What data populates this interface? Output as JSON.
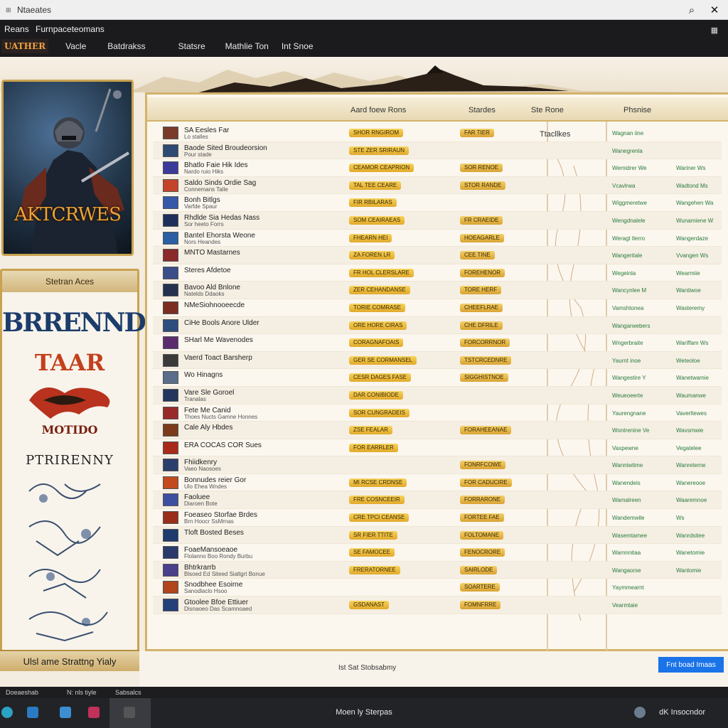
{
  "window": {
    "title": "Ntaeates",
    "app_icon": "window-icon"
  },
  "topbar": {
    "brand_main": "Reans",
    "brand_sub": "Furnpaceteomans",
    "menu_icon": "grid-icon",
    "logo": "UATHER",
    "nav": [
      "Vacle",
      "Batdrakss",
      "Statsre",
      "Mathlie Ton",
      "Int Snoe"
    ]
  },
  "cover": {
    "title": "AKTCRWES"
  },
  "sidebar": {
    "header": "Stetran Aces",
    "title1": "BRRENND",
    "title2": "TAAR",
    "title3": "MOTIDO",
    "title4": "PTRIRENNY",
    "footer": "Ulsl ame Strattng Yialy"
  },
  "table": {
    "headers": [
      "Aard foew Rons",
      "Stardes",
      "Ste Rone",
      "Phsnise"
    ],
    "features_label": "Ttacllkes",
    "rows": [
      {
        "name": "SA Eesles Far",
        "sub": "Lo stalles",
        "tag1": "SHOR RNGIROM",
        "tag2": "FAR TIER",
        "g1": "Wagnan iine",
        "g2": "",
        "color": "#7a3b2a"
      },
      {
        "name": "Baode Sited Broudeorsion",
        "sub": "Pour stade",
        "tag1": "STE ZER SRIRAUN",
        "tag2": "",
        "g1": "Wanegrenla",
        "g2": "",
        "color": "#2c4a73"
      },
      {
        "name": "Bhatlo Faie Hik Ides",
        "sub": "Nardo ruio Hiks",
        "tag1": "CEAMOR CEAPRION",
        "tag2": "SOR RENOE",
        "g1": "Wemidrer We",
        "g2": "Wariner Ws",
        "color": "#3b3b9a"
      },
      {
        "name": "Saldo Sinds Ordie Sag",
        "sub": "Connemans Talle",
        "tag1": "TAL TEE CEARE",
        "tag2": "STOR RANDE",
        "g1": "Vcavlrwa",
        "g2": "Wadtond Ms",
        "color": "#c4442a"
      },
      {
        "name": "Bonh Bitlgs",
        "sub": "Varfde Spaur",
        "tag1": "FIR RBILARAS",
        "tag2": "",
        "g1": "Wiggmeretwe",
        "g2": "Wangehen Wa",
        "color": "#3559a8"
      },
      {
        "name": "Rhdlde Sia Hedas Nass",
        "sub": "Sor heeto Forrs",
        "tag1": "SOM CEAIRAEAS",
        "tag2": "FR CRAEIDE",
        "g1": "Wengdnalele",
        "g2": "Wunamiene W",
        "color": "#1e2f5c"
      },
      {
        "name": "Bantel Ehorsta Weone",
        "sub": "Nors Heandes",
        "tag1": "FHEARN HEI",
        "tag2": "HOEAGARLE",
        "g1": "Weragt tlerro",
        "g2": "Wangerdaze",
        "color": "#2a5fa3"
      },
      {
        "name": "MNTO Mastarnes",
        "sub": "",
        "tag1": "ZA FOREN LR",
        "tag2": "CEE TINE",
        "g1": "Wangeritale",
        "g2": "Vvangen Ws",
        "color": "#8a2a2a"
      },
      {
        "name": "Steres Afdetoe",
        "sub": "",
        "tag1": "FR HOL CLERSLARE",
        "tag2": "FOREHENOR",
        "g1": "Wegeinla",
        "g2": "Wearmiie",
        "color": "#3a4f8a"
      },
      {
        "name": "Bavoo Ald Bnlone",
        "sub": "Natelds Ddaoks",
        "tag1": "ZER CEHANDANSE",
        "tag2": "TORE HERF",
        "g1": "Wancynlee M",
        "g2": "Wantiwoe",
        "color": "#25324f"
      },
      {
        "name": "NMeSiohnooeecde",
        "sub": "",
        "tag1": "TORIE COMRASE",
        "tag2": "CHEEFLRAE",
        "g1": "Vamshtonea",
        "g2": "Wasteremy",
        "color": "#7c2d22"
      },
      {
        "name": "CiHe Bools Anore Ulder",
        "sub": "",
        "tag1": "ORE HORE CIRAS",
        "tag2": "CHE DFRILE",
        "g1": "Wangarwebers",
        "g2": "",
        "color": "#2e4d7f"
      },
      {
        "name": "SHarl Me Wavenodes",
        "sub": "",
        "tag1": "CORAGNAFOAIS",
        "tag2": "FORCORRNOR",
        "g1": "Wngerbraite",
        "g2": "Wariffam Ws",
        "color": "#5b2d6e"
      },
      {
        "name": "Vaerd Toact Barsherp",
        "sub": "",
        "tag1": "GER SE CORMANSEL",
        "tag2": "TSTCRCEDNRE",
        "g1": "Yaurnt inoe",
        "g2": "Weteoloe",
        "color": "#3a3a3a"
      },
      {
        "name": "Wo Hinagns",
        "sub": "",
        "tag1": "CESR DAGES FASE",
        "tag2": "SIGGHISTNOE",
        "g1": "Wangestire Y",
        "g2": "Wanetwamie",
        "color": "#5a6d8a"
      },
      {
        "name": "Vare Sle Goroel",
        "sub": "Tranalas",
        "tag1": "DAR CONIBIODE",
        "tag2": "",
        "g1": "Weueoeerte",
        "g2": "Waumanwe",
        "color": "#24365e"
      },
      {
        "name": "Fete Me Canid",
        "sub": "Thoes Nucts Gamne Honnes",
        "tag1": "SOR CUNGRADEIS",
        "tag2": "",
        "g1": "Yaurengnane",
        "g2": "Vaverltewes",
        "color": "#9a2a2a"
      },
      {
        "name": "Cale Aly Hbdes",
        "sub": "",
        "tag1": "ZSE FEALAR",
        "tag2": "FORAHEEANAE",
        "g1": "Wontrenine Ve",
        "g2": "Wavsmwie",
        "color": "#7c3a1a"
      },
      {
        "name": "ERA COCAS COR Sues",
        "sub": "",
        "tag1": "FOR EARRLER",
        "tag2": "",
        "g1": "Vaxpewne",
        "g2": "Vegatelee",
        "color": "#aa2a1a"
      },
      {
        "name": "Fhiidkenry",
        "sub": "Vaeo Naosoes",
        "tag1": "",
        "tag2": "FONRFCOWE",
        "g1": "Wanniwtime",
        "g2": "Wanreterne",
        "color": "#2b3f6c"
      },
      {
        "name": "Bonnudes reier Gor",
        "sub": "Ulo Ehea Wndes",
        "tag1": "MI RCSE CRDNSE",
        "tag2": "FOR CADUCIRE",
        "g1": "Wanendeis",
        "g2": "Wanereooe",
        "color": "#c24a1e"
      },
      {
        "name": "Faoluee",
        "sub": "Diaroen Bote",
        "tag1": "FRE COSNCEEIR",
        "tag2": "FORRARONE",
        "g1": "Wamalreen",
        "g2": "Waaremnoe",
        "color": "#3d4fa0"
      },
      {
        "name": "Foeaseo Storfae Brdes",
        "sub": "Brn Hoocr SsMrnas",
        "tag1": "CRE TPCI CEANSE",
        "tag2": "FORTEE FAE",
        "g1": "Wandemwile",
        "g2": "Ws",
        "color": "#9a2e1a"
      },
      {
        "name": "Tloft Bosted Beses",
        "sub": "",
        "tag1": "SR FIER TTITE",
        "tag2": "FOLTOMANE",
        "g1": "Wasemtamee",
        "g2": "Wanrdsitee",
        "color": "#1e3a6e"
      },
      {
        "name": "FoaeMansoeaoe",
        "sub": "Flolanno Boo Rondy Burbu",
        "tag1": "SE FAMOCEE",
        "tag2": "FENOCRORE",
        "g1": "Wamnnitaa",
        "g2": "Wanetomie",
        "color": "#2a3a6a"
      },
      {
        "name": "Bhtrkrarrb",
        "sub": "Blsoed Ed Siteed Sialtgrt Bonue",
        "tag1": "FRERATORNEE",
        "tag2": "SAIRLODE",
        "g1": "Wangaorse",
        "g2": "Wanlomie",
        "color": "#4a3f8a"
      },
      {
        "name": "Snodbhee Esoirne",
        "sub": "Sanodlaclo Hsoo",
        "tag1": "",
        "tag2": "SOARTERE",
        "g1": "Yaymmearnt",
        "g2": "",
        "color": "#b0451e"
      },
      {
        "name": "Gtoolee Bfoe Ettiuer",
        "sub": "Disnaoeo Das Scamnoaed",
        "tag1": "GSDANAST",
        "tag2": "FOMNFRRE",
        "g1": "Vearmtaie",
        "g2": "",
        "color": "#23407a"
      }
    ]
  },
  "footer": {
    "center_text": "Ist Sat Stobsabmy",
    "button": "Fnt boad Imaas"
  },
  "statusbar": {
    "left": "Doeaeshab",
    "mid": "N: nls tiyle",
    "right": "Sabsalcs"
  },
  "taskbar": {
    "center": "Moen ly Sterpas",
    "right": "dK Insocndor"
  }
}
